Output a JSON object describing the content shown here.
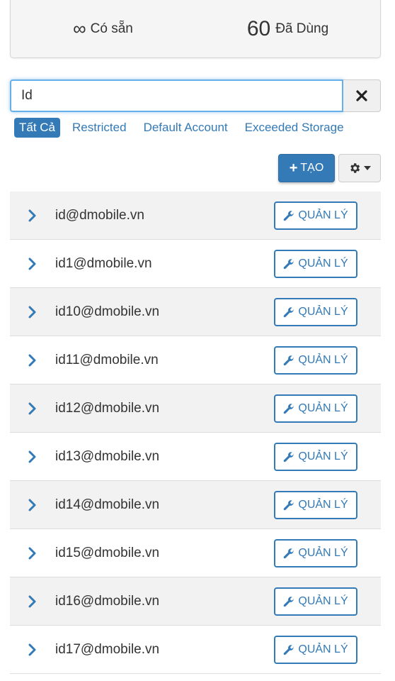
{
  "stats": {
    "available": {
      "value": "∞",
      "label": "Có sẵn"
    },
    "used": {
      "value": "60",
      "label": "Đã Dùng"
    }
  },
  "search": {
    "value": "Id"
  },
  "filters": [
    "Tất Cả",
    "Restricted",
    "Default Account",
    "Exceeded Storage"
  ],
  "toolbar": {
    "create_label": "TẠO"
  },
  "manage_label": "QUẢN LÝ",
  "accounts": [
    "id@dmobile.vn",
    "id1@dmobile.vn",
    "id10@dmobile.vn",
    "id11@dmobile.vn",
    "id12@dmobile.vn",
    "id13@dmobile.vn",
    "id14@dmobile.vn",
    "id15@dmobile.vn",
    "id16@dmobile.vn",
    "id17@dmobile.vn"
  ]
}
